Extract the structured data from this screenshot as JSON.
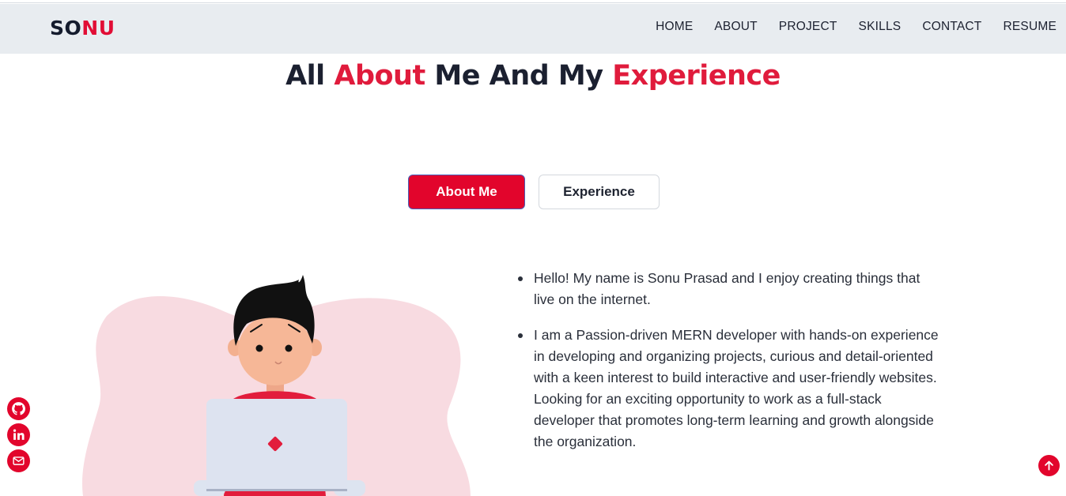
{
  "brand": {
    "part1": "SO",
    "part2": "NU"
  },
  "nav": [
    "HOME",
    "ABOUT",
    "PROJECT",
    "SKILLS",
    "CONTACT",
    "RESUME"
  ],
  "heading": {
    "w1": "All ",
    "w2": "About",
    "w3": " Me And My ",
    "w4": "Experience"
  },
  "tabs": {
    "about": "About Me",
    "experience": "Experience",
    "active": "About Me"
  },
  "bio": [
    "Hello! My name is Sonu Prasad and I enjoy creating things that live on the internet.",
    "I am a Passion-driven MERN developer with hands-on experience in developing and organizing projects, curious and detail-oriented with a keen interest to build interactive and user-friendly websites. Looking for an exciting opportunity to work as a full-stack developer that promotes long-term learning and growth alongside the organization."
  ],
  "social_icons": [
    "github-icon",
    "linkedin-icon",
    "mail-icon"
  ],
  "colors": {
    "accent": "#e2052c",
    "navbar_bg": "#e8ecf0",
    "blob": "#f8dbe1",
    "dark": "#141b2d"
  }
}
